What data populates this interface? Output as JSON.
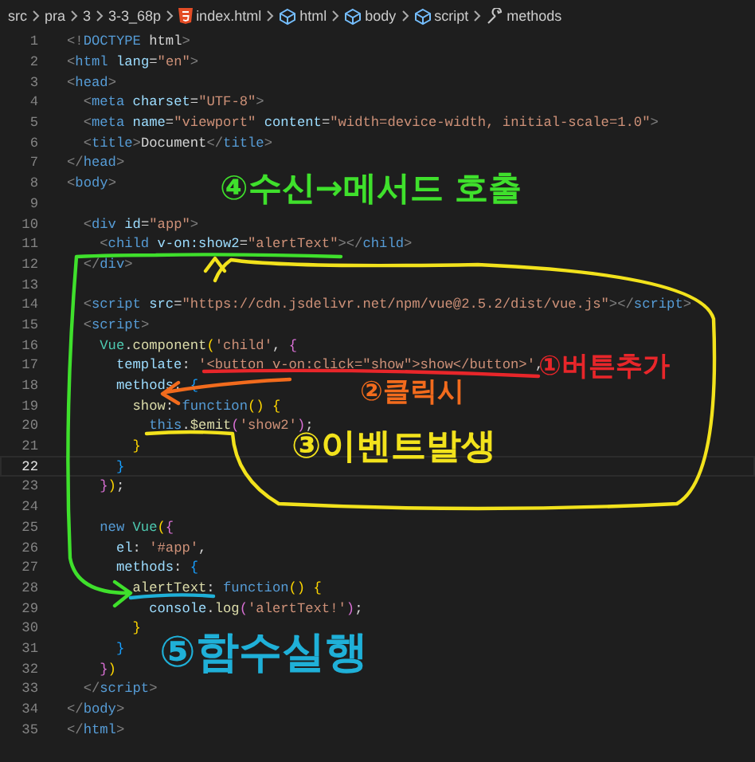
{
  "breadcrumb": [
    {
      "label": "src"
    },
    {
      "label": "pra"
    },
    {
      "label": "3"
    },
    {
      "label": "3-3_68p"
    },
    {
      "label": "index.html"
    },
    {
      "label": "html"
    },
    {
      "label": "body"
    },
    {
      "label": "script"
    },
    {
      "label": "methods"
    }
  ],
  "lines": [
    {
      "number": "1",
      "current": false,
      "tokens": [
        {
          "kind": "p",
          "text": "<!"
        },
        {
          "kind": "tag",
          "text": "DOCTYPE"
        },
        {
          "kind": "txt",
          "text": " html"
        },
        {
          "kind": "p",
          "text": ">"
        }
      ]
    },
    {
      "number": "2",
      "current": false,
      "tokens": [
        {
          "kind": "p",
          "text": "<"
        },
        {
          "kind": "tag",
          "text": "html"
        },
        {
          "kind": "attr",
          "text": " lang"
        },
        {
          "kind": "txt",
          "text": "="
        },
        {
          "kind": "str",
          "text": "\"en\""
        },
        {
          "kind": "p",
          "text": ">"
        }
      ]
    },
    {
      "number": "3",
      "current": false,
      "tokens": [
        {
          "kind": "p",
          "text": "<"
        },
        {
          "kind": "tag",
          "text": "head"
        },
        {
          "kind": "p",
          "text": ">"
        }
      ]
    },
    {
      "number": "4",
      "current": false,
      "tokens": [
        {
          "kind": "p",
          "text": "  <"
        },
        {
          "kind": "tag",
          "text": "meta"
        },
        {
          "kind": "attr",
          "text": " charset"
        },
        {
          "kind": "txt",
          "text": "="
        },
        {
          "kind": "str",
          "text": "\"UTF-8\""
        },
        {
          "kind": "p",
          "text": ">"
        }
      ]
    },
    {
      "number": "5",
      "current": false,
      "tokens": [
        {
          "kind": "p",
          "text": "  <"
        },
        {
          "kind": "tag",
          "text": "meta"
        },
        {
          "kind": "attr",
          "text": " name"
        },
        {
          "kind": "txt",
          "text": "="
        },
        {
          "kind": "str",
          "text": "\"viewport\""
        },
        {
          "kind": "attr",
          "text": " content"
        },
        {
          "kind": "txt",
          "text": "="
        },
        {
          "kind": "str",
          "text": "\"width=device-width, initial-scale=1.0\""
        },
        {
          "kind": "p",
          "text": ">"
        }
      ]
    },
    {
      "number": "6",
      "current": false,
      "tokens": [
        {
          "kind": "p",
          "text": "  <"
        },
        {
          "kind": "tag",
          "text": "title"
        },
        {
          "kind": "p",
          "text": ">"
        },
        {
          "kind": "txt",
          "text": "Document"
        },
        {
          "kind": "p",
          "text": "</"
        },
        {
          "kind": "tag",
          "text": "title"
        },
        {
          "kind": "p",
          "text": ">"
        }
      ]
    },
    {
      "number": "7",
      "current": false,
      "tokens": [
        {
          "kind": "p",
          "text": "</"
        },
        {
          "kind": "tag",
          "text": "head"
        },
        {
          "kind": "p",
          "text": ">"
        }
      ]
    },
    {
      "number": "8",
      "current": false,
      "tokens": [
        {
          "kind": "p",
          "text": "<"
        },
        {
          "kind": "tag",
          "text": "body"
        },
        {
          "kind": "p",
          "text": ">"
        }
      ]
    },
    {
      "number": "9",
      "current": false
    },
    {
      "number": "10",
      "current": false,
      "tokens": [
        {
          "kind": "p",
          "text": "  <"
        },
        {
          "kind": "tag",
          "text": "div"
        },
        {
          "kind": "attr",
          "text": " id"
        },
        {
          "kind": "txt",
          "text": "="
        },
        {
          "kind": "str",
          "text": "\"app\""
        },
        {
          "kind": "p",
          "text": ">"
        }
      ]
    },
    {
      "number": "11",
      "current": false,
      "tokens": [
        {
          "kind": "p",
          "text": "    <"
        },
        {
          "kind": "tag",
          "text": "child"
        },
        {
          "kind": "attr",
          "text": " v-on:show2"
        },
        {
          "kind": "txt",
          "text": "="
        },
        {
          "kind": "str",
          "text": "\"alertText\""
        },
        {
          "kind": "p",
          "text": "></"
        },
        {
          "kind": "tag",
          "text": "child"
        },
        {
          "kind": "p",
          "text": ">"
        }
      ]
    },
    {
      "number": "12",
      "current": false,
      "tokens": [
        {
          "kind": "p",
          "text": "  </"
        },
        {
          "kind": "tag",
          "text": "div"
        },
        {
          "kind": "p",
          "text": ">"
        }
      ]
    },
    {
      "number": "13",
      "current": false
    },
    {
      "number": "14",
      "current": false,
      "tokens": [
        {
          "kind": "p",
          "text": "  <"
        },
        {
          "kind": "tag",
          "text": "script"
        },
        {
          "kind": "attr",
          "text": " src"
        },
        {
          "kind": "txt",
          "text": "="
        },
        {
          "kind": "str",
          "text": "\"https://cdn.jsdelivr.net/npm/vue@2.5.2/dist/vue.js\""
        },
        {
          "kind": "p",
          "text": "></"
        },
        {
          "kind": "tag",
          "text": "script"
        },
        {
          "kind": "p",
          "text": ">"
        }
      ]
    },
    {
      "number": "15",
      "current": false,
      "tokens": [
        {
          "kind": "p",
          "text": "  <"
        },
        {
          "kind": "tag",
          "text": "script"
        },
        {
          "kind": "p",
          "text": ">"
        }
      ]
    },
    {
      "number": "16",
      "current": false,
      "tokens": [
        {
          "kind": "cls",
          "text": "    Vue"
        },
        {
          "kind": "txt",
          "text": "."
        },
        {
          "kind": "fn",
          "text": "component"
        },
        {
          "kind": "b1",
          "text": "("
        },
        {
          "kind": "str",
          "text": "'child'"
        },
        {
          "kind": "txt",
          "text": ", "
        },
        {
          "kind": "b2",
          "text": "{"
        }
      ]
    },
    {
      "number": "17",
      "current": false,
      "tokens": [
        {
          "kind": "var",
          "text": "      template"
        },
        {
          "kind": "txt",
          "text": ": "
        },
        {
          "kind": "str",
          "text": "'<button v-on:click=\"show\">show</button>'"
        },
        {
          "kind": "txt",
          "text": ","
        }
      ]
    },
    {
      "number": "18",
      "current": false,
      "tokens": [
        {
          "kind": "var",
          "text": "      methods"
        },
        {
          "kind": "txt",
          "text": ": "
        },
        {
          "kind": "b3",
          "text": "{"
        }
      ]
    },
    {
      "number": "19",
      "current": false,
      "tokens": [
        {
          "kind": "fn",
          "text": "        show"
        },
        {
          "kind": "txt",
          "text": ": "
        },
        {
          "kind": "kw",
          "text": "function"
        },
        {
          "kind": "b1",
          "text": "() {"
        }
      ]
    },
    {
      "number": "20",
      "current": false,
      "tokens": [
        {
          "kind": "kw",
          "text": "          this"
        },
        {
          "kind": "txt",
          "text": "."
        },
        {
          "kind": "fn",
          "text": "$emit"
        },
        {
          "kind": "b2",
          "text": "("
        },
        {
          "kind": "str",
          "text": "'show2'"
        },
        {
          "kind": "b2",
          "text": ")"
        },
        {
          "kind": "txt",
          "text": ";"
        }
      ]
    },
    {
      "number": "21",
      "current": false,
      "tokens": [
        {
          "kind": "b1",
          "text": "        }"
        }
      ]
    },
    {
      "number": "22",
      "current": true,
      "tokens": [
        {
          "kind": "b3",
          "text": "      }"
        }
      ]
    },
    {
      "number": "23",
      "current": false,
      "tokens": [
        {
          "kind": "b2",
          "text": "    }"
        },
        {
          "kind": "b1",
          "text": ")"
        },
        {
          "kind": "txt",
          "text": ";"
        }
      ]
    },
    {
      "number": "24",
      "current": false
    },
    {
      "number": "25",
      "current": false,
      "tokens": [
        {
          "kind": "kw",
          "text": "    new"
        },
        {
          "kind": "cls",
          "text": " Vue"
        },
        {
          "kind": "b1",
          "text": "("
        },
        {
          "kind": "b2",
          "text": "{"
        }
      ]
    },
    {
      "number": "26",
      "current": false,
      "tokens": [
        {
          "kind": "var",
          "text": "      el"
        },
        {
          "kind": "txt",
          "text": ": "
        },
        {
          "kind": "str",
          "text": "'#app'"
        },
        {
          "kind": "txt",
          "text": ","
        }
      ]
    },
    {
      "number": "27",
      "current": false,
      "tokens": [
        {
          "kind": "var",
          "text": "      methods"
        },
        {
          "kind": "txt",
          "text": ": "
        },
        {
          "kind": "b3",
          "text": "{"
        }
      ]
    },
    {
      "number": "28",
      "current": false,
      "tokens": [
        {
          "kind": "fn",
          "text": "        alertText"
        },
        {
          "kind": "txt",
          "text": ": "
        },
        {
          "kind": "kw",
          "text": "function"
        },
        {
          "kind": "b1",
          "text": "() {"
        }
      ]
    },
    {
      "number": "29",
      "current": false,
      "tokens": [
        {
          "kind": "var",
          "text": "          console"
        },
        {
          "kind": "txt",
          "text": "."
        },
        {
          "kind": "fn",
          "text": "log"
        },
        {
          "kind": "b2",
          "text": "("
        },
        {
          "kind": "str",
          "text": "'alertText!'"
        },
        {
          "kind": "b2",
          "text": ")"
        },
        {
          "kind": "txt",
          "text": ";"
        }
      ]
    },
    {
      "number": "30",
      "current": false,
      "tokens": [
        {
          "kind": "b1",
          "text": "        }"
        }
      ]
    },
    {
      "number": "31",
      "current": false,
      "tokens": [
        {
          "kind": "b3",
          "text": "      }"
        }
      ]
    },
    {
      "number": "32",
      "current": false,
      "tokens": [
        {
          "kind": "b2",
          "text": "    }"
        },
        {
          "kind": "b1",
          "text": ")"
        }
      ]
    },
    {
      "number": "33",
      "current": false,
      "tokens": [
        {
          "kind": "p",
          "text": "  </"
        },
        {
          "kind": "tag",
          "text": "script"
        },
        {
          "kind": "p",
          "text": ">"
        }
      ]
    },
    {
      "number": "34",
      "current": false,
      "tokens": [
        {
          "kind": "p",
          "text": "</"
        },
        {
          "kind": "tag",
          "text": "body"
        },
        {
          "kind": "p",
          "text": ">"
        }
      ]
    },
    {
      "number": "35",
      "current": false,
      "tokens": [
        {
          "kind": "p",
          "text": "</"
        },
        {
          "kind": "tag",
          "text": "html"
        },
        {
          "kind": "p",
          "text": ">"
        }
      ]
    }
  ],
  "annotations": [
    {
      "text": "④수신→메서드 호출",
      "color": "#3fe02c"
    },
    {
      "text": "①버튼추가",
      "color": "#e8262a"
    },
    {
      "text": "②클릭시",
      "color": "#f26b1d"
    },
    {
      "text": "③이벤트발생",
      "color": "#f2e21c"
    },
    {
      "text": "⑤함수실행",
      "color": "#1fb0d8"
    }
  ]
}
